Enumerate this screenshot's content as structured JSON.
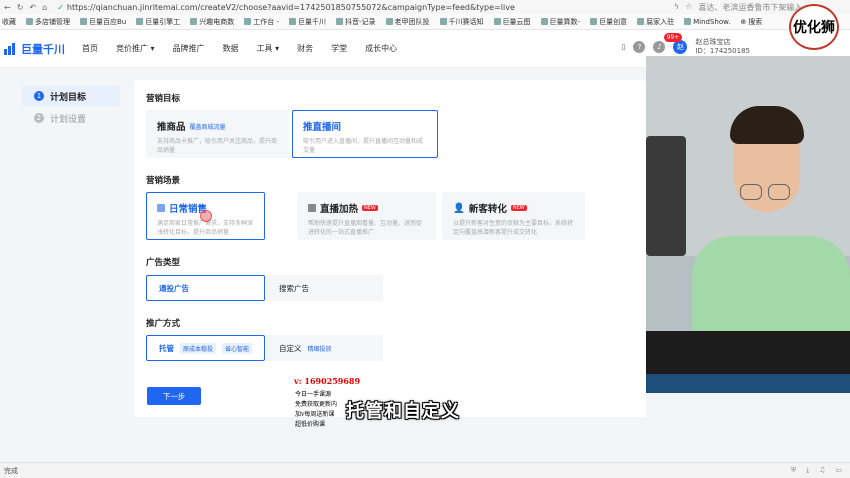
{
  "browser": {
    "url": "https://qianchuan.jinritemai.com/createV2/choose?aavid=1742501850755072&campaignType=feed&type=live",
    "right_text": "喜达、老滨运香鲁市下架输入..."
  },
  "bookmarks": [
    "收藏",
    "多店铺管理",
    "巨量百应Bu",
    "巨量引擎工",
    "兴趣电商数",
    "工作台 -",
    "巨量千川",
    "抖音-记录",
    "老甲团队投",
    "千川赛话知",
    "巨量云图",
    "巨量算数-",
    "巨量创意",
    "腐家入驻",
    "MindShow.",
    "搜索"
  ],
  "app": {
    "logo": "巨量千川",
    "menu": [
      "首页",
      "竞价推广 ▾",
      "品牌推广",
      "数据",
      "工具 ▾",
      "财务",
      "学堂",
      "成长中心"
    ],
    "badge": "99+",
    "account_name": "赵总珠宝店",
    "account_id": "ID：174250185"
  },
  "sidebar": {
    "steps": [
      {
        "num": "1",
        "label": "计划目标"
      },
      {
        "num": "2",
        "label": "计划设置"
      }
    ]
  },
  "marketing_goal": {
    "title": "营销目标",
    "cards": [
      {
        "title": "推商品",
        "tag": "覆盖商城流量",
        "desc": "支持商品卡推广，吸引用户关注商品，提升商品销量"
      },
      {
        "title": "推直播间",
        "tag": "",
        "desc": "吸引用户进入直播间，提升直播间互动量和成交量"
      }
    ]
  },
  "scene": {
    "title": "营销场景",
    "cards": [
      {
        "title": "日常销售",
        "new": "",
        "desc": "满足商家日常推广需求，支持多种深浅转化目标，提升商品销量"
      },
      {
        "title": "直播加热",
        "new": "NEW",
        "desc": "帮助快速提升直播观看量、互动量，进而促进转化的一站式直播推广"
      },
      {
        "title": "新客转化",
        "new": "NEW",
        "desc": "以提升新客对生意的贡献为主要目标，系统将定向覆盖高潜新客提升成交转化"
      }
    ]
  },
  "ad_type": {
    "title": "广告类型",
    "options": [
      "通投广告",
      "搜索广告"
    ]
  },
  "promo_method": {
    "title": "推广方式",
    "options": [
      {
        "label": "托管",
        "tags": [
          "原成本稳投",
          "省心智能"
        ]
      },
      {
        "label": "自定义",
        "tags": [
          "精细投放"
        ]
      }
    ]
  },
  "next_button": "下一步",
  "overlay": {
    "contact": "v: 1690259689",
    "promo_lines": [
      "今日一手课源",
      "免费获取更新内",
      "加v每周送新课",
      "超低价购课"
    ],
    "subtitle": "托管和自定义",
    "seal": "优化狮"
  },
  "statusbar": {
    "left": "完成"
  }
}
